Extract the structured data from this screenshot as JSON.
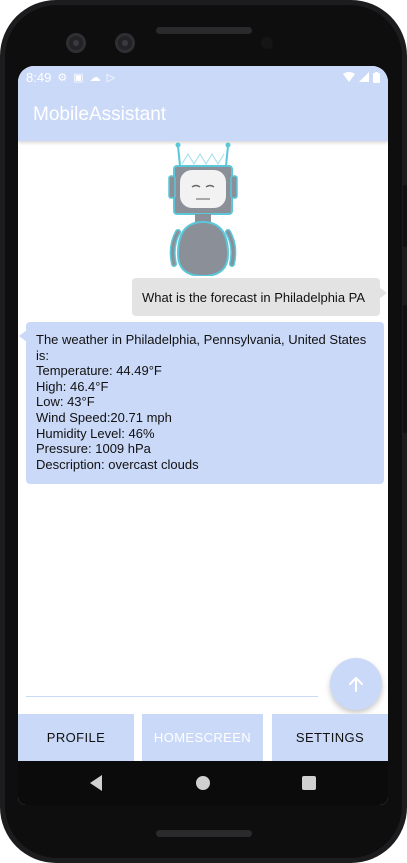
{
  "status_bar": {
    "time": "8:49"
  },
  "app": {
    "title": "MobileAssistant"
  },
  "chat": {
    "user_message": "What is the forecast in Philadelphia PA",
    "bot_lines": [
      "The weather in Philadelphia, Pennsylvania, United States",
      "is:",
      "Temperature: 44.49°F",
      "High: 46.4°F",
      "Low:  43°F",
      "Wind Speed:20.71 mph",
      "Humidity Level:  46%",
      "Pressure:  1009 hPa",
      "Description:  overcast clouds"
    ]
  },
  "input": {
    "value": ""
  },
  "nav": {
    "profile": "PROFILE",
    "homescreen": "HOMESCREEN",
    "settings": "SETTINGS"
  },
  "icons": {
    "send": "arrow-up-icon",
    "back": "back-triangle-icon",
    "home": "home-circle-icon",
    "recents": "recents-square-icon"
  },
  "colors": {
    "accent": "#cad9f8",
    "bot_bubble": "#cad9f8",
    "user_bubble": "#e3e3e3",
    "robot_body": "#8a8f98",
    "robot_outline": "#5bc7d9"
  }
}
